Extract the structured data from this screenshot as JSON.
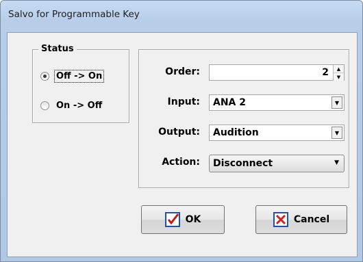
{
  "window": {
    "title": "Salvo for Programmable Key"
  },
  "status_group": {
    "legend": "Status",
    "options": [
      {
        "label": "Off -> On",
        "selected": true
      },
      {
        "label": "On -> Off",
        "selected": false
      }
    ]
  },
  "form": {
    "order_label": "Order:",
    "order_value": "2",
    "input_label": "Input:",
    "input_value": "ANA 2",
    "output_label": "Output:",
    "output_value": "Audition",
    "action_label": "Action:",
    "action_value": "Disconnect"
  },
  "buttons": {
    "ok_label": "OK",
    "cancel_label": "Cancel"
  },
  "colors": {
    "titlebar": "#b9cfe9",
    "check_icon": "#1f4fb0",
    "cancel_icon": "#d41f1f"
  },
  "icons": {
    "ok": "checkmark-icon",
    "cancel": "x-icon"
  }
}
